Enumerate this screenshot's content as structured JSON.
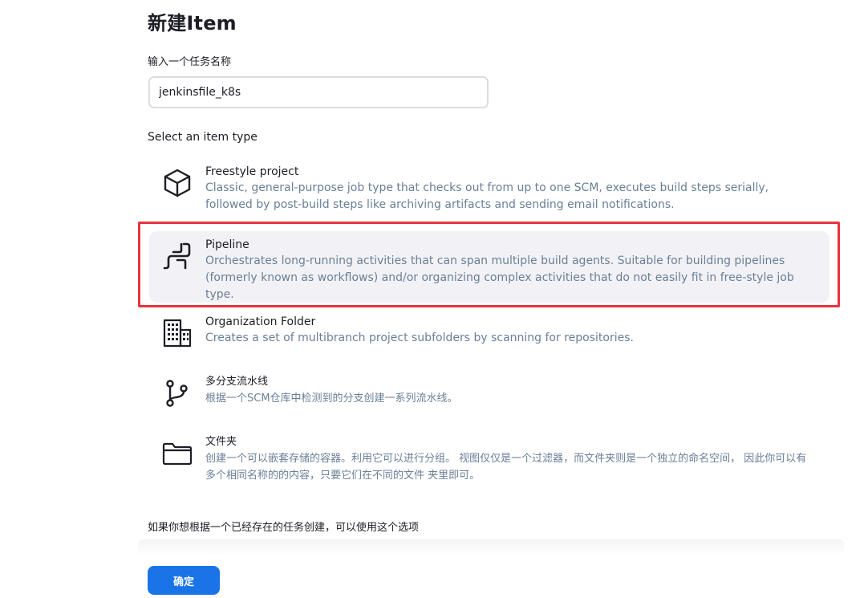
{
  "page": {
    "title": "新建Item"
  },
  "name_field": {
    "label": "输入一个任务名称",
    "value": "jenkinsfile_k8s"
  },
  "item_type": {
    "label": "Select an item type"
  },
  "items": [
    {
      "title": "Freestyle project",
      "description": "Classic, general-purpose job type that checks out from up to one SCM, executes build steps serially, followed by post-build steps like archiving artifacts and sending email notifications.",
      "icon": "cube-icon",
      "selected": false
    },
    {
      "title": "Pipeline",
      "description": "Orchestrates long-running activities that can span multiple build agents. Suitable for building pipelines (formerly known as workflows) and/or organizing complex activities that do not easily fit in free-style job type.",
      "icon": "pipeline-icon",
      "selected": true
    },
    {
      "title": "Organization Folder",
      "description": "Creates a set of multibranch project subfolders by scanning for repositories.",
      "icon": "building-icon",
      "selected": false
    },
    {
      "title": "多分支流水线",
      "description": "根据一个SCM仓库中检测到的分支创建一系列流水线。",
      "icon": "branch-icon",
      "selected": false
    },
    {
      "title": "文件夹",
      "description": "创建一个可以嵌套存储的容器。利用它可以进行分组。 视图仅仅是一个过滤器，而文件夹则是一个独立的命名空间， 因此你可以有多个相同名称的的内容，只要它们在不同的文件 夹里即可。",
      "icon": "folder-icon",
      "selected": false
    }
  ],
  "copy_from": {
    "label": "如果你想根据一个已经存在的任务创建，可以使用这个选项"
  },
  "actions": {
    "ok_label": "确定"
  },
  "colors": {
    "accent": "#1a74e8",
    "highlight": "#e8343f",
    "description": "#6a7f97",
    "selected_bg": "#f2f2f6"
  }
}
